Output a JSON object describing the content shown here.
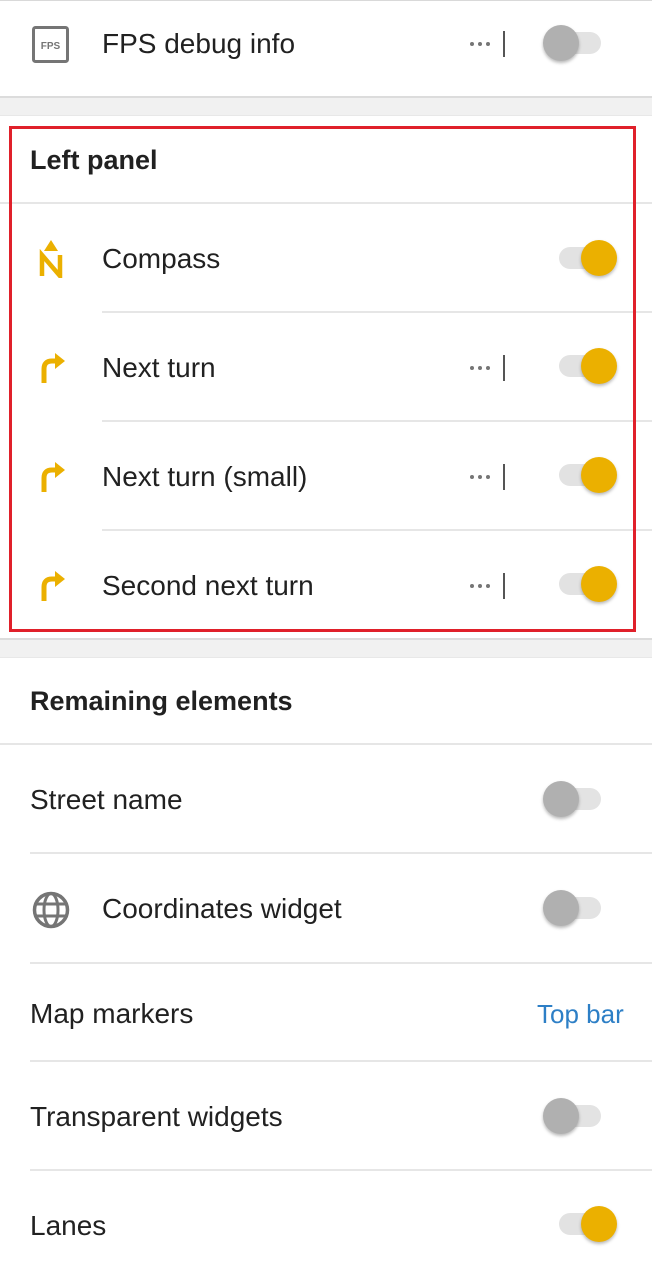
{
  "colors": {
    "accent": "#ebb000",
    "link": "#2d7fc6",
    "highlight_border": "#e0202a"
  },
  "top_items": [
    {
      "label": "FPS debug info",
      "icon": "fps-icon",
      "toggle": "off",
      "has_more": true
    }
  ],
  "left_panel": {
    "title": "Left panel",
    "items": [
      {
        "label": "Compass",
        "icon": "compass-north-icon",
        "toggle": "on",
        "has_more": false
      },
      {
        "label": "Next turn",
        "icon": "turn-right-arrow-icon",
        "toggle": "on",
        "has_more": true
      },
      {
        "label": "Next turn (small)",
        "icon": "turn-right-arrow-icon",
        "toggle": "on",
        "has_more": true
      },
      {
        "label": "Second next turn",
        "icon": "turn-right-arrow-icon",
        "toggle": "on",
        "has_more": true
      }
    ]
  },
  "remaining": {
    "title": "Remaining elements",
    "items": [
      {
        "label": "Street name",
        "toggle": "off"
      },
      {
        "label": "Coordinates widget",
        "icon": "globe-icon",
        "toggle": "off"
      },
      {
        "label": "Map markers",
        "value": "Top bar"
      },
      {
        "label": "Transparent widgets",
        "toggle": "off"
      },
      {
        "label": "Lanes",
        "toggle": "on"
      }
    ]
  }
}
